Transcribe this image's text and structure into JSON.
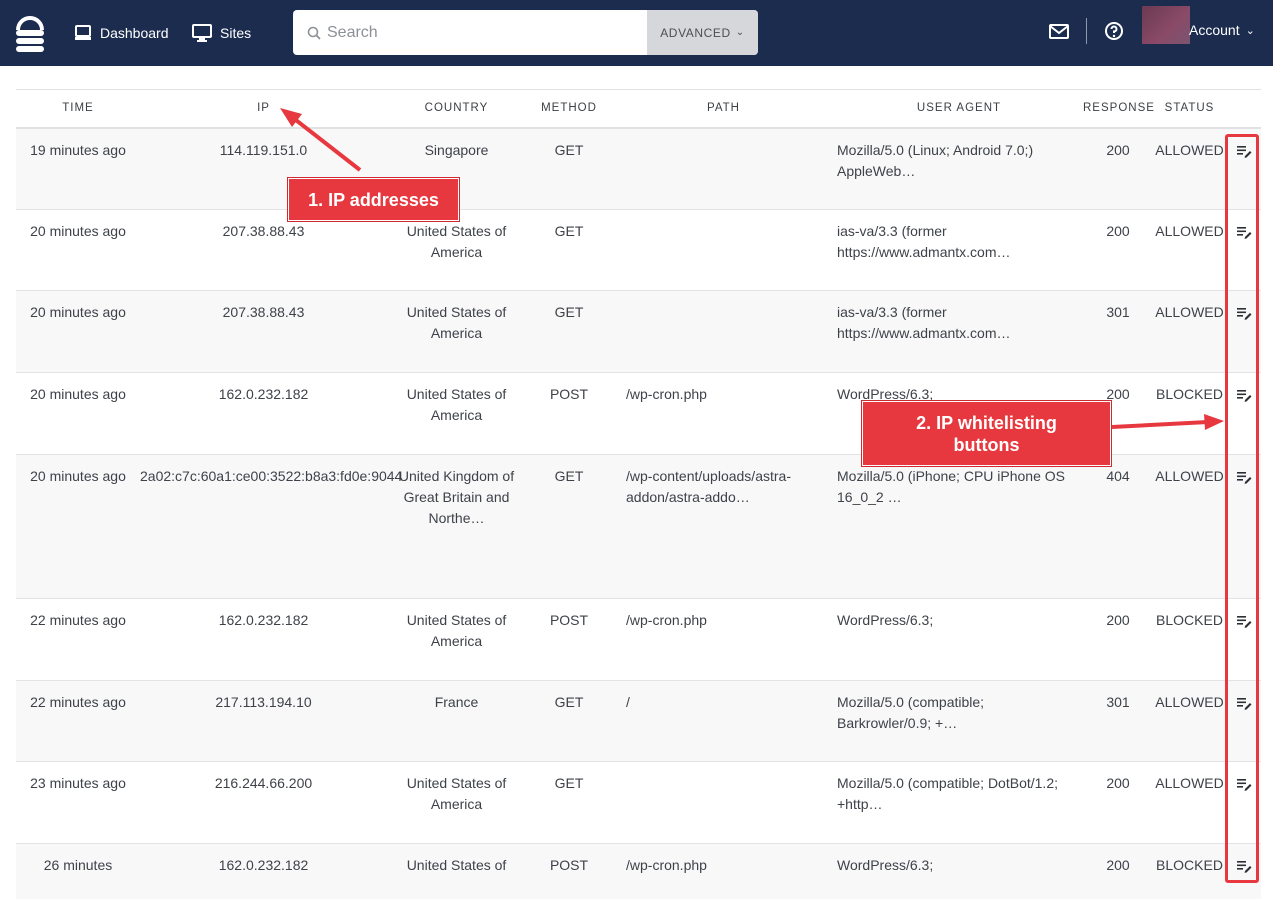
{
  "nav": {
    "dashboard_label": "Dashboard",
    "sites_label": "Sites",
    "search_placeholder": "Search",
    "advanced_label": "ADVANCED",
    "account_label": "Account"
  },
  "table": {
    "headers": {
      "time": "TIME",
      "ip": "IP",
      "country": "COUNTRY",
      "method": "METHOD",
      "path": "PATH",
      "user_agent": "USER AGENT",
      "response": "RESPONSE",
      "status": "STATUS"
    },
    "rows": [
      {
        "time": "19 minutes ago",
        "ip": "114.119.151.0",
        "country": "Singapore",
        "method": "GET",
        "path": "",
        "path_redacted": true,
        "user_agent": "Mozilla/5.0 (Linux; Android 7.0;) AppleWeb…",
        "response": "200",
        "status": "ALLOWED"
      },
      {
        "time": "20 minutes ago",
        "ip": "207.38.88.43",
        "country": "United States of America",
        "method": "GET",
        "path": "",
        "path_redacted": true,
        "user_agent": "ias-va/3.3 (former https://www.admantx.com…",
        "response": "200",
        "status": "ALLOWED"
      },
      {
        "time": "20 minutes ago",
        "ip": "207.38.88.43",
        "country": "United States of America",
        "method": "GET",
        "path": "",
        "path_redacted": true,
        "user_agent": "ias-va/3.3 (former https://www.admantx.com…",
        "response": "301",
        "status": "ALLOWED"
      },
      {
        "time": "20 minutes ago",
        "ip": "162.0.232.182",
        "country": "United States of America",
        "method": "POST",
        "path": "/wp-cron.php",
        "path_redacted": false,
        "user_agent": "WordPress/6.3;",
        "response": "200",
        "status": "BLOCKED"
      },
      {
        "time": "20 minutes ago",
        "ip": "2a02:c7c:60a1:ce00:3522:b8a3:fd0e:9044",
        "country": "United Kingdom of Great Britain and Northe…",
        "method": "GET",
        "path": "/wp-content/uploads/astra-addon/astra-addo…",
        "path_redacted": false,
        "user_agent": "Mozilla/5.0 (iPhone; CPU iPhone OS 16_0_2 …",
        "response": "404",
        "status": "ALLOWED"
      },
      {
        "time": "22 minutes ago",
        "ip": "162.0.232.182",
        "country": "United States of America",
        "method": "POST",
        "path": "/wp-cron.php",
        "path_redacted": false,
        "user_agent": "WordPress/6.3;",
        "response": "200",
        "status": "BLOCKED"
      },
      {
        "time": "22 minutes ago",
        "ip": "217.113.194.10",
        "country": "France",
        "method": "GET",
        "path": "/",
        "path_redacted": false,
        "user_agent": "Mozilla/5.0 (compatible; Barkrowler/0.9; +…",
        "response": "301",
        "status": "ALLOWED"
      },
      {
        "time": "23 minutes ago",
        "ip": "216.244.66.200",
        "country": "United States of America",
        "method": "GET",
        "path": "",
        "path_redacted": true,
        "user_agent": "Mozilla/5.0 (compatible; DotBot/1.2; +http…",
        "response": "200",
        "status": "ALLOWED"
      },
      {
        "time": "26 minutes",
        "ip": "162.0.232.182",
        "country": "United States of",
        "method": "POST",
        "path": "/wp-cron.php",
        "path_redacted": false,
        "user_agent": "WordPress/6.3;",
        "response": "200",
        "status": "BLOCKED"
      }
    ]
  },
  "annotations": {
    "callout_1": "1. IP addresses",
    "callout_2_line1": "2. IP whitelisting",
    "callout_2_line2": "buttons",
    "accent_color": "#e8383f"
  },
  "icons": {
    "logo": "sucuri-logo-icon",
    "dashboard": "monitor-icon",
    "sites": "desktop-icon",
    "search": "search-icon",
    "mail": "mail-icon",
    "help": "help-circle-icon",
    "whitelist": "whitelist-edit-icon"
  },
  "colors": {
    "topbar": "#1c2c4f",
    "row_alt": "#f8f8f9",
    "advanced_button": "#d5d7da"
  }
}
